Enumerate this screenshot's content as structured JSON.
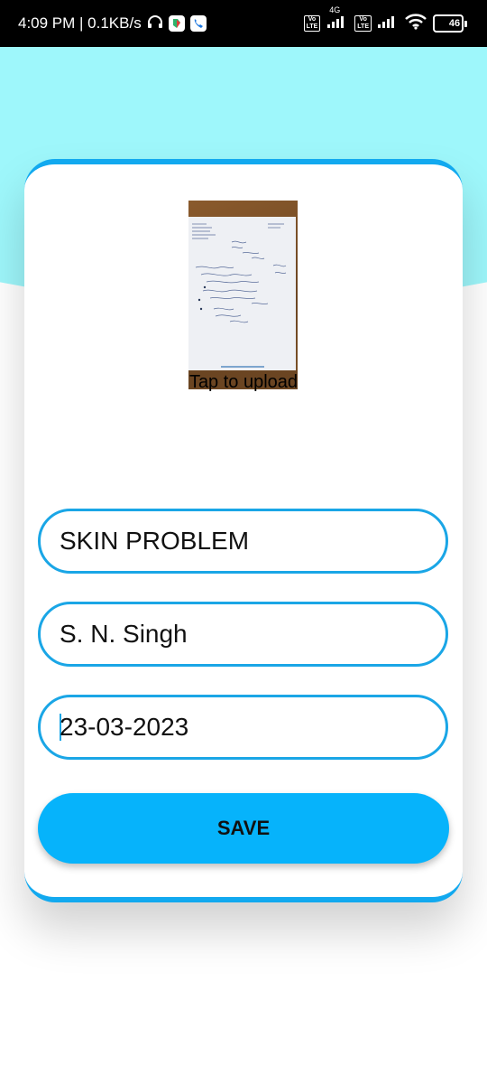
{
  "status_bar": {
    "time_speed": "4:09 PM | 0.1KB/s",
    "network_label": "4G",
    "volte_label": "Vo LTE",
    "battery_level": "46",
    "icons": [
      "headset-icon",
      "app-icon",
      "phone-icon",
      "signal-icon",
      "wifi-icon",
      "battery-icon"
    ]
  },
  "upload": {
    "label": "Tap to upload",
    "image": "prescription-photo"
  },
  "form": {
    "problem_value": "SKIN PROBLEM",
    "doctor_value": "S. N. Singh",
    "date_value": "23-03-2023",
    "save_label": "SAVE"
  },
  "colors": {
    "accent": "#12a9ef",
    "header_bg": "#9ef7fb",
    "button": "#06b3fb"
  }
}
